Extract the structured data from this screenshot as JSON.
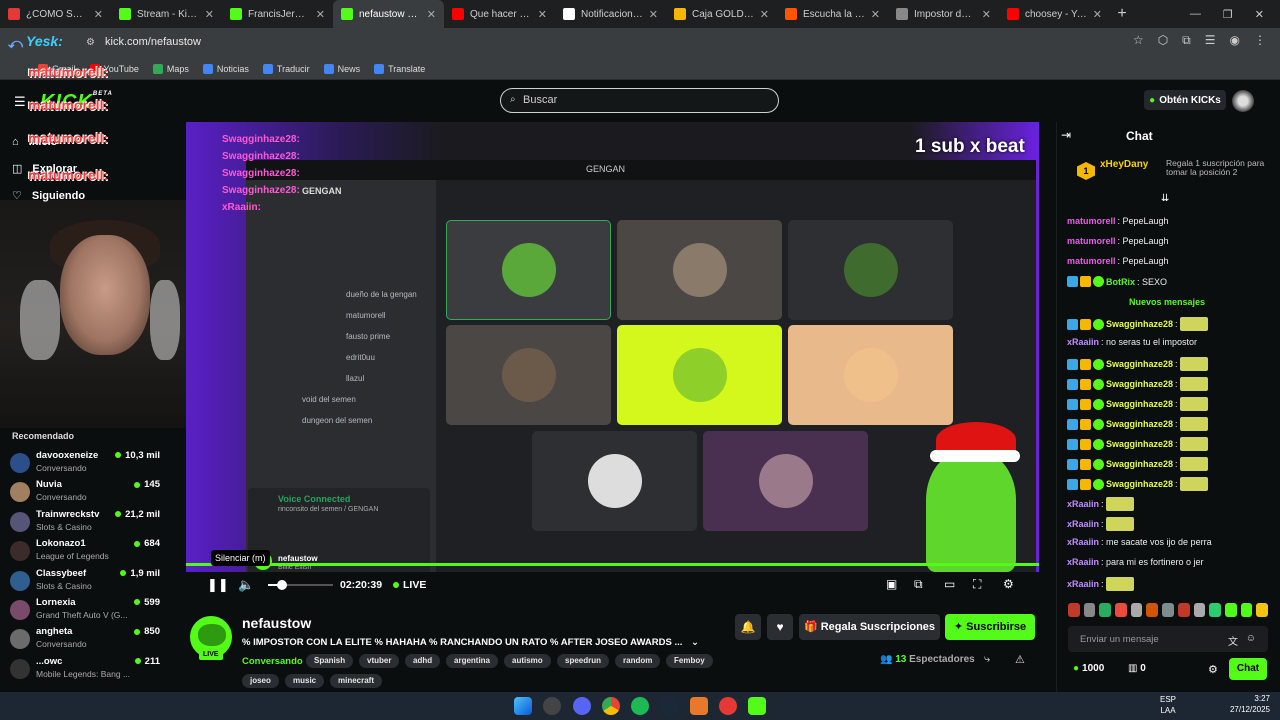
{
  "browser": {
    "tabs": [
      {
        "title": "¿CÓMO SE PRA...",
        "fav_color": "#e53935"
      },
      {
        "title": "Stream - Kick Da...",
        "fav_color": "#53fc18"
      },
      {
        "title": "FrancisJeremy Stre...",
        "fav_color": "#53fc18"
      },
      {
        "title": "nefaustow Str...",
        "fav_color": "#53fc18",
        "active": true
      },
      {
        "title": "Que hacer cuand...",
        "fav_color": "#ff0000"
      },
      {
        "title": "Notificaciones / X",
        "fav_color": "#ffffff"
      },
      {
        "title": "Caja GOLD DIGGE...",
        "fav_color": "#f5b800"
      },
      {
        "title": "Escucha la música...",
        "fav_color": "#ff5500"
      },
      {
        "title": "Impostor del Und...",
        "fav_color": "#888888"
      },
      {
        "title": "choosey - YouTub...",
        "fav_color": "#ff0000"
      }
    ],
    "url": "kick.com/nefaustow",
    "bookmarks": [
      "Gmail",
      "YouTube",
      "Maps",
      "Noticias",
      "Traducir",
      "News",
      "Translate"
    ]
  },
  "header": {
    "logo": "KICK",
    "logo_badge": "BETA",
    "search_placeholder": "Buscar",
    "get_kicks": "Obtén KICKs"
  },
  "sidebar": {
    "nav": [
      {
        "label": "Inicio",
        "icon": "home-icon"
      },
      {
        "label": "Explorar",
        "icon": "compass-icon"
      },
      {
        "label": "Siguiendo",
        "icon": "heart-icon"
      }
    ],
    "overlay_name": "matumorell:",
    "recommended_title": "Recomendado",
    "recommended": [
      {
        "name": "davooxeneize",
        "category": "Conversando",
        "viewers": "10,3 mil",
        "color": "#2c4e8a"
      },
      {
        "name": "Nuvia",
        "category": "Conversando",
        "viewers": "145",
        "color": "#a08060"
      },
      {
        "name": "Trainwreckstv",
        "category": "Slots & Casino",
        "viewers": "21,2 mil",
        "color": "#555577"
      },
      {
        "name": "Lokonazo1",
        "category": "League of Legends",
        "viewers": "684",
        "color": "#3b2b2b"
      },
      {
        "name": "Classybeef",
        "category": "Slots & Casino",
        "viewers": "1,9 mil",
        "color": "#2f5f8f"
      },
      {
        "name": "Lornexia",
        "category": "Grand Theft Auto V (G...",
        "viewers": "599",
        "color": "#7a4a6a"
      },
      {
        "name": "angheta",
        "category": "Conversando",
        "viewers": "850",
        "color": "#6b6b6b"
      },
      {
        "name": "...owc",
        "category": "Mobile Legends: Bang ...",
        "viewers": "211",
        "color": "#333333"
      }
    ]
  },
  "video": {
    "banner": "1 sub x beat",
    "discord_title": "GENGAN",
    "discord_server": "GENGAN",
    "channels": [
      "dueño de la gengan",
      "matumorell",
      "fausto prime",
      "edrit0uu",
      "llazul",
      "void del semen",
      "dungeon del semen"
    ],
    "voice_status": "Voice Connected",
    "voice_channel": "rinconsito del semen / GENGAN",
    "user": "nefaustow",
    "user_status": "Billie Eilish",
    "overlay_chat": [
      "Swagginhaze28:",
      "Swagginhaze28:",
      "Swagginhaze28:",
      "Swagginhaze28:",
      "xRaaiin:"
    ],
    "tooltip": "Silenciar (m)",
    "time": "02:20:39",
    "live": "LIVE",
    "volume_fraction": 0.15
  },
  "stream": {
    "channel": "nefaustow",
    "live_badge": "LIVE",
    "title": "% IMPOSTOR CON LA ELITE % HAHAHA % RANCHANDO UN RATO % AFTER JOSEO AWARDS ...",
    "category": "Conversando",
    "tags": [
      "Spanish",
      "vtuber",
      "adhd",
      "argentina",
      "autismo",
      "speedrun",
      "random",
      "Femboy",
      "joseo",
      "music",
      "minecraft"
    ],
    "gift_label": "Regala Suscripciones",
    "subscribe_label": "Suscribirse",
    "viewers": "13",
    "viewers_label": "Espectadores"
  },
  "chat": {
    "title": "Chat",
    "pinned_user": "xHeyDany",
    "pinned_rank": "1",
    "pinned_text": "Regala 1 suscripción para tomar la posición 2",
    "new_messages": "Nuevos mensajes",
    "messages": [
      {
        "user": "matumorell",
        "text": ": PepeLaugh",
        "color": "#e65ce6"
      },
      {
        "user": "matumorell",
        "text": ": PepeLaugh",
        "color": "#e65ce6"
      },
      {
        "user": "matumorell",
        "text": ": PepeLaugh",
        "color": "#e65ce6"
      },
      {
        "user": "BotRix",
        "text": ": SEXO",
        "color": "#53fc18"
      },
      {
        "user": "Swagginhaze28",
        "text": ":",
        "color": "#e9ff4a"
      },
      {
        "user": "xRaaiin",
        "text": ": no seras tu el impostor",
        "color": "#c28cff"
      },
      {
        "user": "Swagginhaze28",
        "text": ":",
        "color": "#e9ff4a"
      },
      {
        "user": "Swagginhaze28",
        "text": ":",
        "color": "#e9ff4a"
      },
      {
        "user": "Swagginhaze28",
        "text": ":",
        "color": "#e9ff4a"
      },
      {
        "user": "Swagginhaze28",
        "text": ":",
        "color": "#e9ff4a"
      },
      {
        "user": "Swagginhaze28",
        "text": ":",
        "color": "#e9ff4a"
      },
      {
        "user": "Swagginhaze28",
        "text": ":",
        "color": "#e9ff4a"
      },
      {
        "user": "Swagginhaze28",
        "text": ":",
        "color": "#e9ff4a"
      },
      {
        "user": "xRaaiin",
        "text": ":",
        "color": "#c28cff"
      },
      {
        "user": "xRaaiin",
        "text": ":",
        "color": "#c28cff"
      },
      {
        "user": "xRaaiin",
        "text": ": me sacate vos ijo de perra",
        "color": "#c28cff"
      },
      {
        "user": "xRaaiin",
        "text": ": para mi es fortinero o jer",
        "color": "#c28cff"
      },
      {
        "user": "xRaaiin",
        "text": ":",
        "color": "#c28cff"
      }
    ],
    "input_placeholder": "Enviar un mensaje",
    "kicks": "1000",
    "gifts": "0",
    "send_label": "Chat"
  },
  "taskbar": {
    "lang": "ESP",
    "lang2": "LAA",
    "time": "3:27",
    "date": "27/12/2025"
  }
}
